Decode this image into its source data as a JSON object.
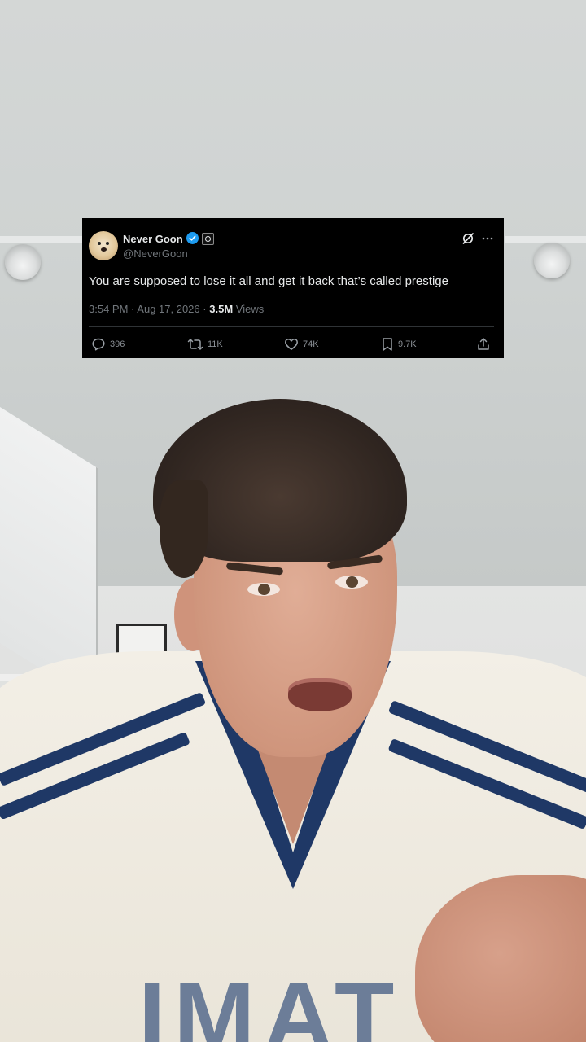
{
  "tweet": {
    "author_name": "Never Goon",
    "handle": "@NeverGoon",
    "text": "You are supposed to lose it all and get it back that’s called prestige",
    "time": "3:54 PM",
    "date": "Aug 17, 2026",
    "separator": "·",
    "views_count": "3.5M",
    "views_label": "Views",
    "replies": "396",
    "reposts": "11K",
    "likes": "74K",
    "bookmarks": "9.7K",
    "verified_color": "#1d9bf0"
  },
  "background": {
    "shirt_letters": "IMAT"
  }
}
